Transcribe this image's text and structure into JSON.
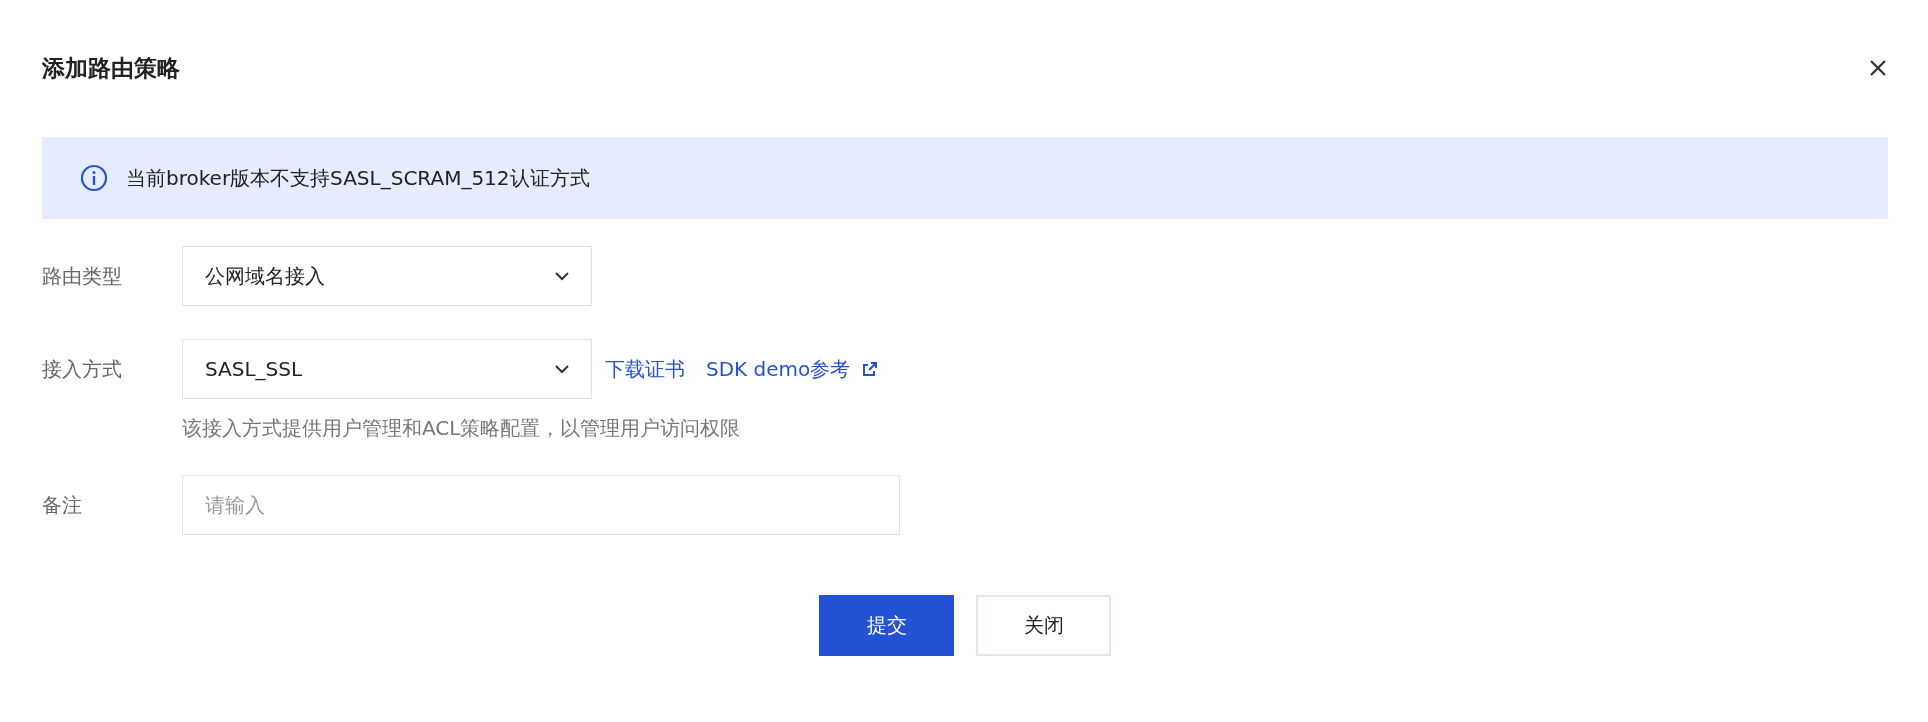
{
  "dialog": {
    "title": "添加路由策略"
  },
  "alert": {
    "text": "当前broker版本不支持SASL_SCRAM_512认证方式"
  },
  "form": [
    {
      "kind": "select",
      "label": "路由类型",
      "value": "公网域名接入"
    },
    {
      "kind": "select",
      "label": "接入方式",
      "value": "SASL_SSL",
      "links": [
        {
          "text": "下载证书",
          "external": false
        },
        {
          "text": "SDK demo参考",
          "external": true
        }
      ],
      "hint": "该接入方式提供用户管理和ACL策略配置，以管理用户访问权限"
    },
    {
      "kind": "input",
      "label": "备注",
      "placeholder": "请输入"
    }
  ],
  "buttons": [
    {
      "label": "提交",
      "primary": true
    },
    {
      "label": "关闭",
      "primary": false
    }
  ]
}
